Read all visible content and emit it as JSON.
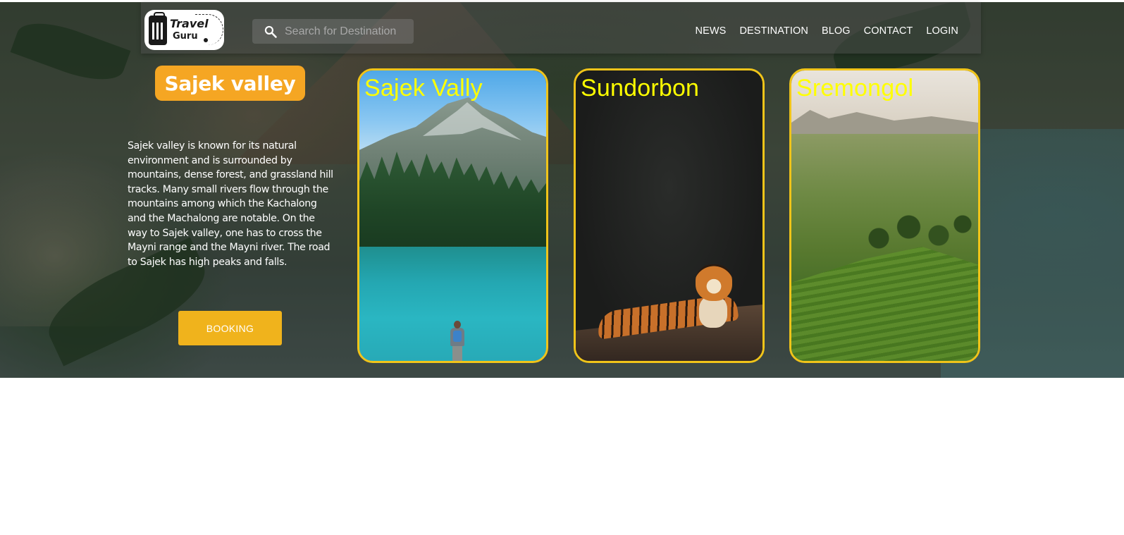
{
  "brand": {
    "logo_line1": "Travel",
    "logo_line2": "Guru"
  },
  "search": {
    "placeholder": "Search for Destination",
    "value": ""
  },
  "nav": {
    "items": [
      "NEWS",
      "DESTINATION",
      "BLOG",
      "CONTACT",
      "LOGIN"
    ]
  },
  "featured": {
    "title": "Sajek valley",
    "description": "Sajek valley is known for its natural environment and is surrounded by mountains, dense forest, and grassland hill tracks. Many small rivers flow through the mountains among which the Kachalong and the Machalong are notable. On the way to Sajek valley, one has to cross the Mayni range and the Mayni river. The road to Sajek has high peaks and falls.",
    "button_label": "BOOKING"
  },
  "cards": [
    {
      "label": "Sajek Vally"
    },
    {
      "label": "Sundorbon"
    },
    {
      "label": "Sremongol"
    }
  ],
  "colors": {
    "accent": "#f5a623",
    "button": "#f0b31c",
    "card_border": "#f0c419",
    "card_label": "#ffff00"
  }
}
